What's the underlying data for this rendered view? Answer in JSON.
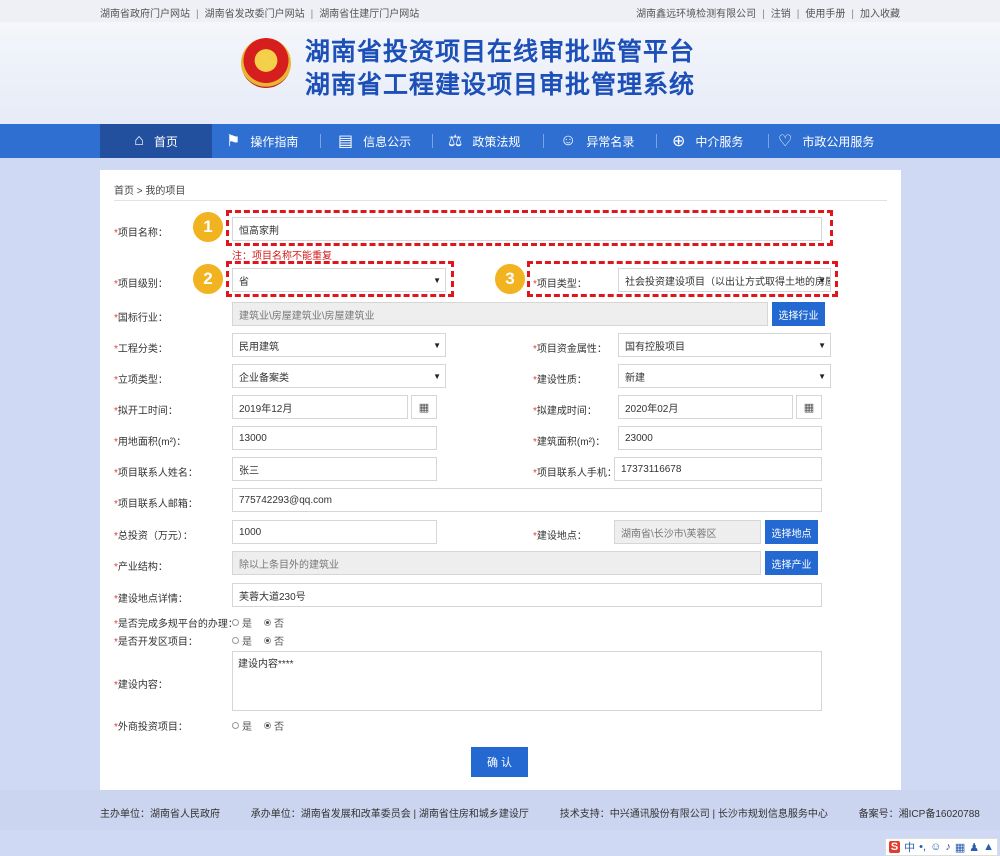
{
  "topbar": {
    "left_links": [
      "湖南省政府门户网站",
      "湖南省发改委门户网站",
      "湖南省住建厅门户网站"
    ],
    "company": "湖南鑫远环境检测有限公司",
    "logout": "注销",
    "manual": "使用手册",
    "favorite": "加入收藏"
  },
  "header": {
    "title_line1": "湖南省投资项目在线审批监管平台",
    "title_line2": "湖南省工程建设项目审批管理系统"
  },
  "nav": [
    {
      "label": "首页",
      "icon": "home-icon",
      "glyph": "⌂"
    },
    {
      "label": "操作指南",
      "icon": "flag-icon",
      "glyph": "⚑"
    },
    {
      "label": "信息公示",
      "icon": "document-icon",
      "glyph": "▤"
    },
    {
      "label": "政策法规",
      "icon": "scales-icon",
      "glyph": "⚖"
    },
    {
      "label": "异常名录",
      "icon": "user-list-icon",
      "glyph": "☺"
    },
    {
      "label": "中介服务",
      "icon": "service-icon",
      "glyph": "⊕"
    },
    {
      "label": "市政公用服务",
      "icon": "heart-icon",
      "glyph": "♡"
    }
  ],
  "breadcrumb": {
    "home": "首页",
    "sep": ">",
    "current": "我的项目"
  },
  "form": {
    "project_name": {
      "label": "项目名称：",
      "value": "恒高家荆",
      "note": "注：项目名称不能重复"
    },
    "project_level": {
      "label": "项目级别：",
      "value": "省"
    },
    "project_type": {
      "label": "项目类型：",
      "value": "社会投资建设项目（以出让方式取得土地的房屋建"
    },
    "national_industry": {
      "label": "国标行业：",
      "value": "建筑业\\房屋建筑业\\房屋建筑业",
      "button": "选择行业"
    },
    "engineering_class": {
      "label": "工程分类：",
      "value": "民用建筑"
    },
    "fund_property": {
      "label": "项目资金属性：",
      "value": "国有控股项目"
    },
    "approval_type": {
      "label": "立项类型：",
      "value": "企业备案类"
    },
    "construction_nature": {
      "label": "建设性质：",
      "value": "新建"
    },
    "start_date": {
      "label": "拟开工时间：",
      "value": "2019年12月"
    },
    "completion_date": {
      "label": "拟建成时间：",
      "value": "2020年02月"
    },
    "land_area": {
      "label": "用地面积(m²)：",
      "value": "13000"
    },
    "building_area": {
      "label": "建筑面积(m²)：",
      "value": "23000"
    },
    "contact_name": {
      "label": "项目联系人姓名：",
      "value": "张三"
    },
    "contact_phone": {
      "label": "项目联系人手机：",
      "value": "17373116678"
    },
    "contact_email": {
      "label": "项目联系人邮箱：",
      "value": "775742293@qq.com"
    },
    "total_investment": {
      "label": "总投资（万元）：",
      "value": "1000"
    },
    "construction_site": {
      "label": "建设地点：",
      "value": "湖南省\\长沙市\\芙蓉区",
      "button": "选择地点"
    },
    "industry_structure": {
      "label": "产业结构：",
      "value": "除以上条目外的建筑业",
      "button": "选择产业"
    },
    "site_detail": {
      "label": "建设地点详情：",
      "value": "芙蓉大道230号"
    },
    "multi_platform": {
      "label": "是否完成多规平台的办理：",
      "yes": "是",
      "no": "否",
      "selected": "否"
    },
    "dev_zone": {
      "label": "是否开发区项目：",
      "yes": "是",
      "no": "否",
      "selected": "否"
    },
    "content": {
      "label": "建设内容：",
      "value": "建设内容****"
    },
    "foreign_investment": {
      "label": "外商投资项目：",
      "yes": "是",
      "no": "否",
      "selected": "否"
    },
    "required_mark": "*"
  },
  "confirm_button": "确 认",
  "annotations": [
    "1",
    "2",
    "3"
  ],
  "footer": {
    "host": "主办单位：湖南省人民政府",
    "organizer": "承办单位：湖南省发展和改革委员会 | 湖南省住房和城乡建设厅",
    "tech": "技术支持：中兴通讯股份有限公司 | 长沙市规划信息服务中心",
    "icp": "备案号：湘ICP备16020788"
  },
  "ime": {
    "logo": "S",
    "mode": "中",
    "punct": "•,"
  },
  "colors": {
    "nav": "#2f6fd2",
    "nav_active": "#22509f",
    "button": "#2369d1",
    "highlight": "#e0161c",
    "badge": "#f2b321"
  }
}
